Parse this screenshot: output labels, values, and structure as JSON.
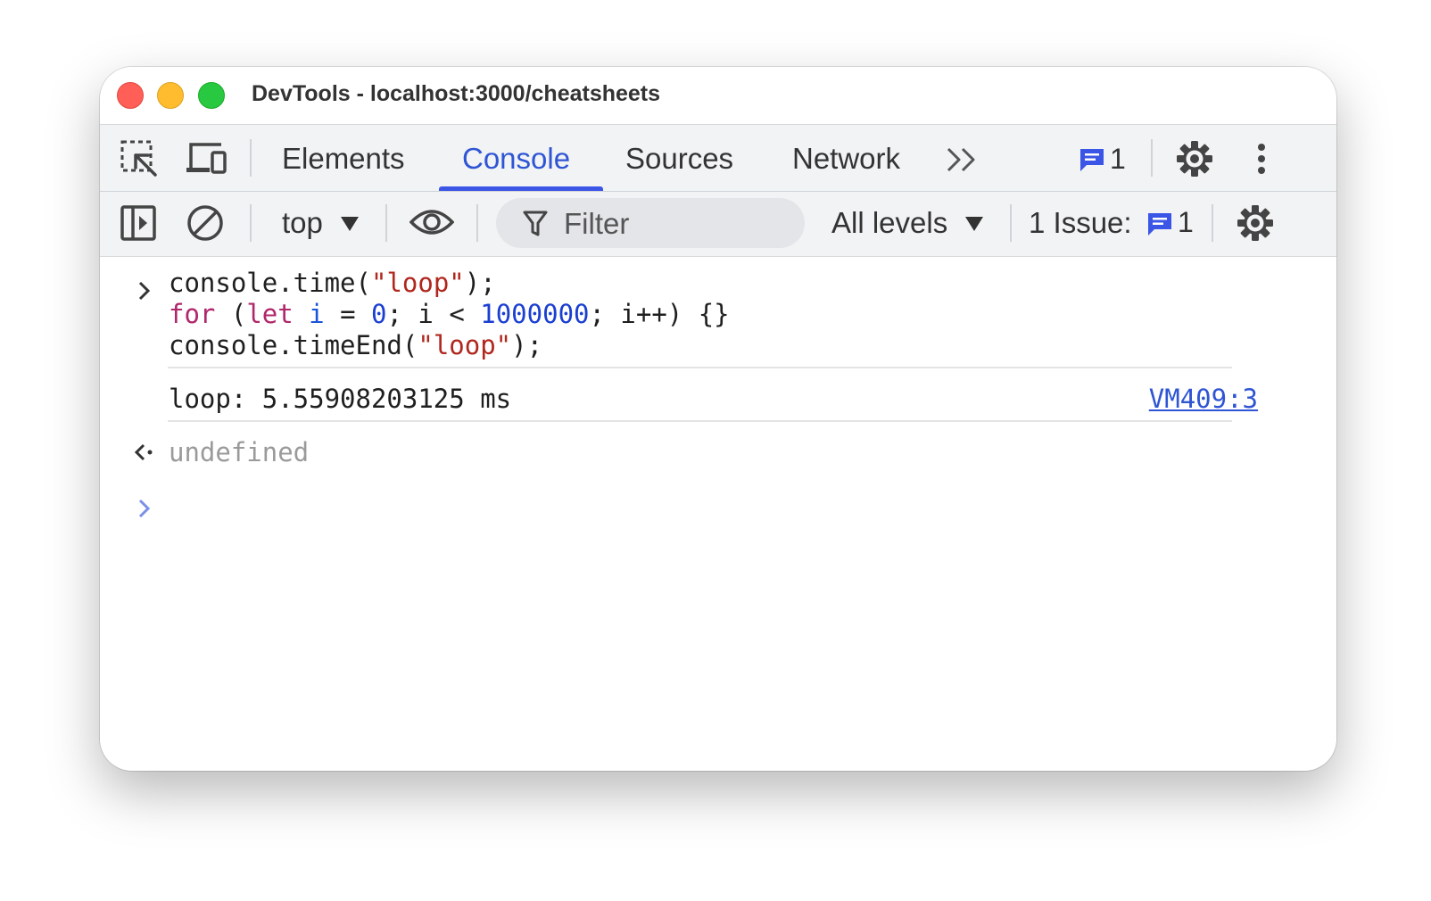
{
  "window": {
    "title": "DevTools - localhost:3000/cheatsheets"
  },
  "tabs": [
    {
      "label": "Elements",
      "active": false
    },
    {
      "label": "Console",
      "active": true
    },
    {
      "label": "Sources",
      "active": false
    },
    {
      "label": "Network",
      "active": false
    }
  ],
  "tabbar": {
    "issues_badge_count": "1"
  },
  "toolbar": {
    "context": "top",
    "filter_placeholder": "Filter",
    "levels": "All levels",
    "issues_label": "1 Issue:",
    "issues_count": "1"
  },
  "console": {
    "input_code": {
      "line1": {
        "a": "console.time(",
        "b": "\"loop\"",
        "c": ");"
      },
      "line2": {
        "kw_for": "for",
        "p1": " (",
        "kw_let": "let",
        "sp": " ",
        "var_i": "i",
        "eq": " = ",
        "zero": "0",
        "mid": "; i < ",
        "num": "1000000",
        "tail": "; i++) {}"
      },
      "line3": {
        "a": "console.timeEnd(",
        "b": "\"loop\"",
        "c": ");"
      }
    },
    "log_message": "loop: 5.55908203125 ms",
    "log_source": "VM409:3",
    "result": "undefined"
  },
  "colors": {
    "accent": "#3b55e6",
    "keyword": "#b0276b",
    "string": "#b0271e",
    "number": "#1a3fd1"
  },
  "icons": [
    "inspect-element-icon",
    "device-toolbar-icon",
    "more-tabs-icon",
    "issues-message-icon",
    "settings-gear-icon",
    "kebab-menu-icon",
    "sidebar-toggle-icon",
    "clear-console-icon",
    "dropdown-triangle-icon",
    "live-expression-eye-icon",
    "filter-funnel-icon",
    "console-settings-gear-icon",
    "input-chevron-icon",
    "result-arrow-icon",
    "prompt-chevron-icon"
  ]
}
